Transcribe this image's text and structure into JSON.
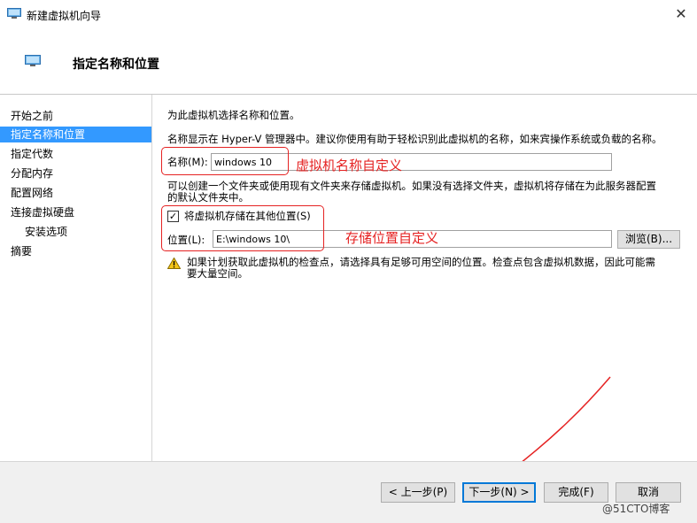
{
  "window": {
    "title": "新建虚拟机向导",
    "close_glyph": "✕"
  },
  "header": {
    "title": "指定名称和位置"
  },
  "sidebar": {
    "items": [
      {
        "label": "开始之前"
      },
      {
        "label": "指定名称和位置"
      },
      {
        "label": "指定代数"
      },
      {
        "label": "分配内存"
      },
      {
        "label": "配置网络"
      },
      {
        "label": "连接虚拟硬盘"
      },
      {
        "label": "安装选项"
      },
      {
        "label": "摘要"
      }
    ],
    "active_index": 1
  },
  "main": {
    "intro": "为此虚拟机选择名称和位置。",
    "name_desc": "名称显示在 Hyper-V 管理器中。建议你使用有助于轻松识别此虚拟机的名称，如来宾操作系统或负载的名称。",
    "name_label": "名称(M):",
    "name_value": "windows 10",
    "folder_desc_1": "可以创建一个文件夹或使用现有文件夹来存储虚拟机。如果没有选择文件夹，虚拟机将存储在为此服务器配置",
    "folder_desc_2": "的默认文件夹中。",
    "store_other_label": "将虚拟机存储在其他位置(S)",
    "store_other_checked": true,
    "location_label": "位置(L):",
    "location_value": "E:\\windows 10\\",
    "browse_label": "浏览(B)...",
    "warning_line_1": "如果计划获取此虚拟机的检查点，请选择具有足够可用空间的位置。检查点包含虚拟机数据，因此可能需",
    "warning_line_2": "要大量空间。"
  },
  "annotations": {
    "name_note": "虚拟机名称自定义",
    "location_note": "存储位置自定义",
    "color": "#e52222"
  },
  "footer": {
    "prev_label": "< 上一步(P)",
    "next_label": "下一步(N) >",
    "finish_label": "完成(F)",
    "cancel_label": "取消"
  },
  "watermark": "@51CTO博客",
  "colors": {
    "selection": "#3399ff",
    "accent": "#0078d7",
    "warning": "#f5c518"
  }
}
